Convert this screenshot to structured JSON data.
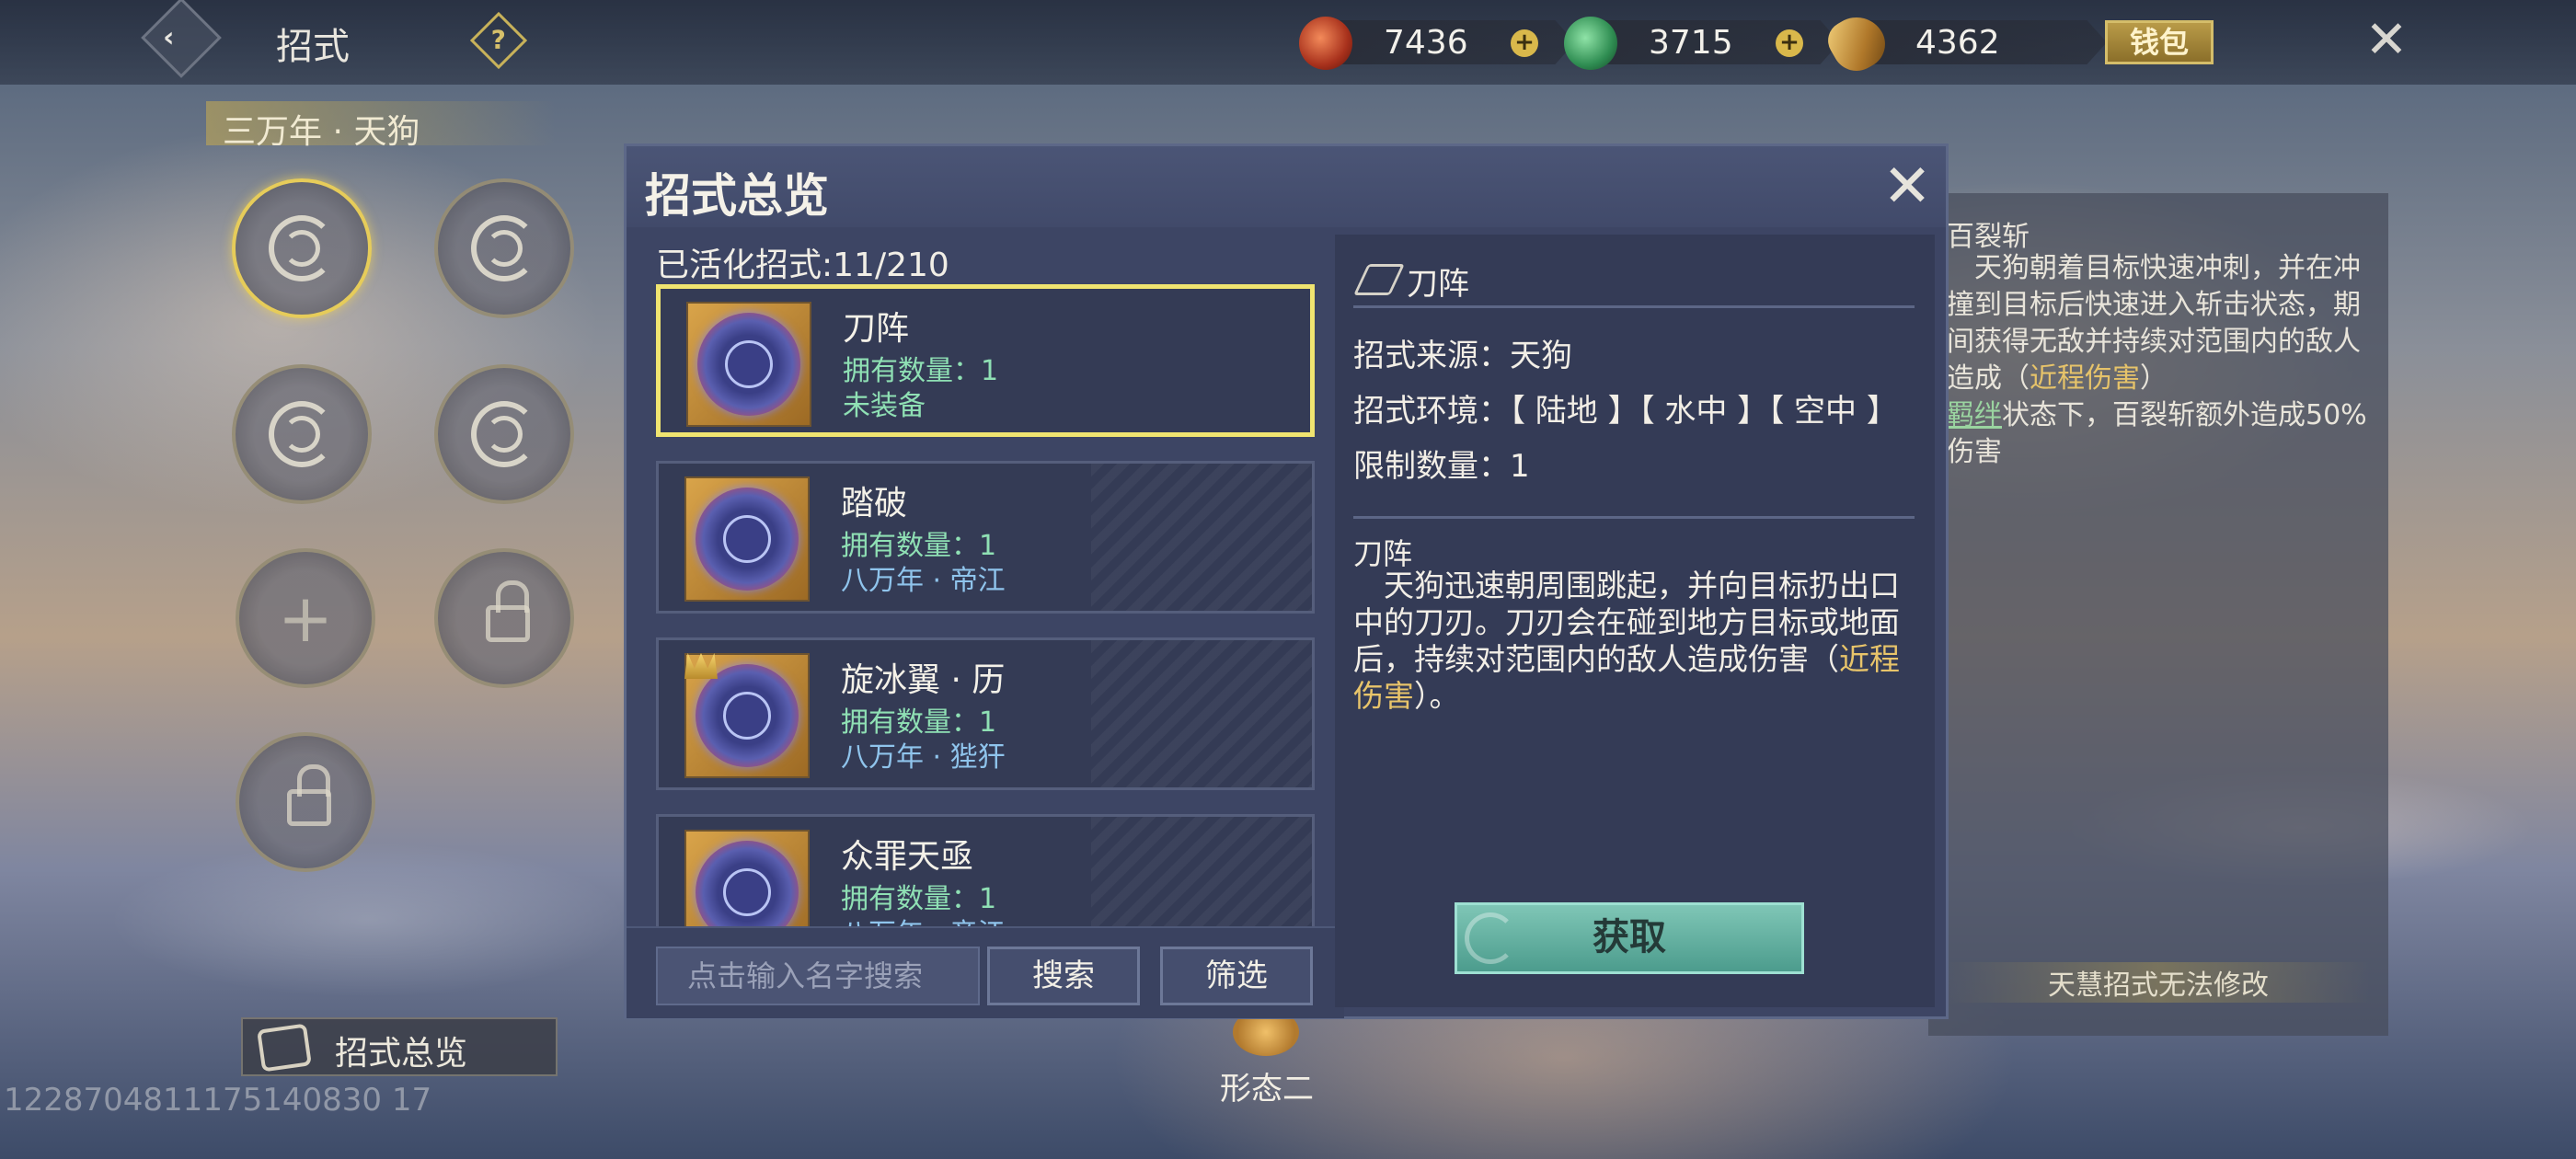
{
  "header": {
    "back_label": "‹",
    "title": "招式",
    "help_label": "?",
    "currencies": [
      {
        "icon": "red-orb-icon",
        "value": "7436",
        "color": "#c8452a"
      },
      {
        "icon": "green-jade-icon",
        "value": "3715",
        "color": "#3aa45f"
      },
      {
        "icon": "gold-shell-icon",
        "value": "4362",
        "color": "#c99538"
      }
    ],
    "currency_add_label": "+",
    "wallet_label": "钱包",
    "close_label": "✕"
  },
  "left_panel": {
    "subtitle": "三万年 · 天狗",
    "overview_tab_label": "招式总览",
    "watermark": "1228704811175140830 17"
  },
  "form_label": "形态二",
  "side_panel": {
    "title": "百裂斩",
    "text_1": "　天狗朝着目标快速冲刺，并在冲撞到目标后快速进入斩击状态，期间获得无敌并持续对范围内的敌人造成（",
    "text_hl": "近程伤害",
    "text_2": "）",
    "text_3_hl": "羁绊",
    "text_3": "状态下，百裂斩额外造成50%伤害",
    "footer": "天慧招式无法修改"
  },
  "modal": {
    "title": "招式总览",
    "close_label": "✕",
    "activated": "已活化招式:11/210",
    "items": [
      {
        "name": "刀阵",
        "count": "拥有数量：1",
        "status": "未装备",
        "selected": true
      },
      {
        "name": "踏破",
        "count": "拥有数量：1",
        "status": "八万年 · 帝江"
      },
      {
        "name": "旋冰翼 · 历",
        "count": "拥有数量：1",
        "status": "八万年 · 狴犴"
      },
      {
        "name": "众罪天亟",
        "count": "拥有数量：1",
        "status": "八万年 · 帝江"
      }
    ],
    "search_placeholder": "点击输入名字搜索",
    "search_label": "搜索",
    "filter_label": "筛选",
    "detail": {
      "title": "刀阵",
      "source": "招式来源：天狗",
      "environment": "招式环境：【 陆地 】【 水中 】【 空中 】",
      "limit": "限制数量：1",
      "name": "刀阵",
      "desc_1": "　天狗迅速朝周围跳起，并向目标扔出口中的刀刃。刀刃会在碰到地方目标或地面后，持续对范围内的敌人造成伤害（",
      "desc_hl": "近程伤害",
      "desc_2": "）。",
      "get_label": "获取"
    }
  }
}
